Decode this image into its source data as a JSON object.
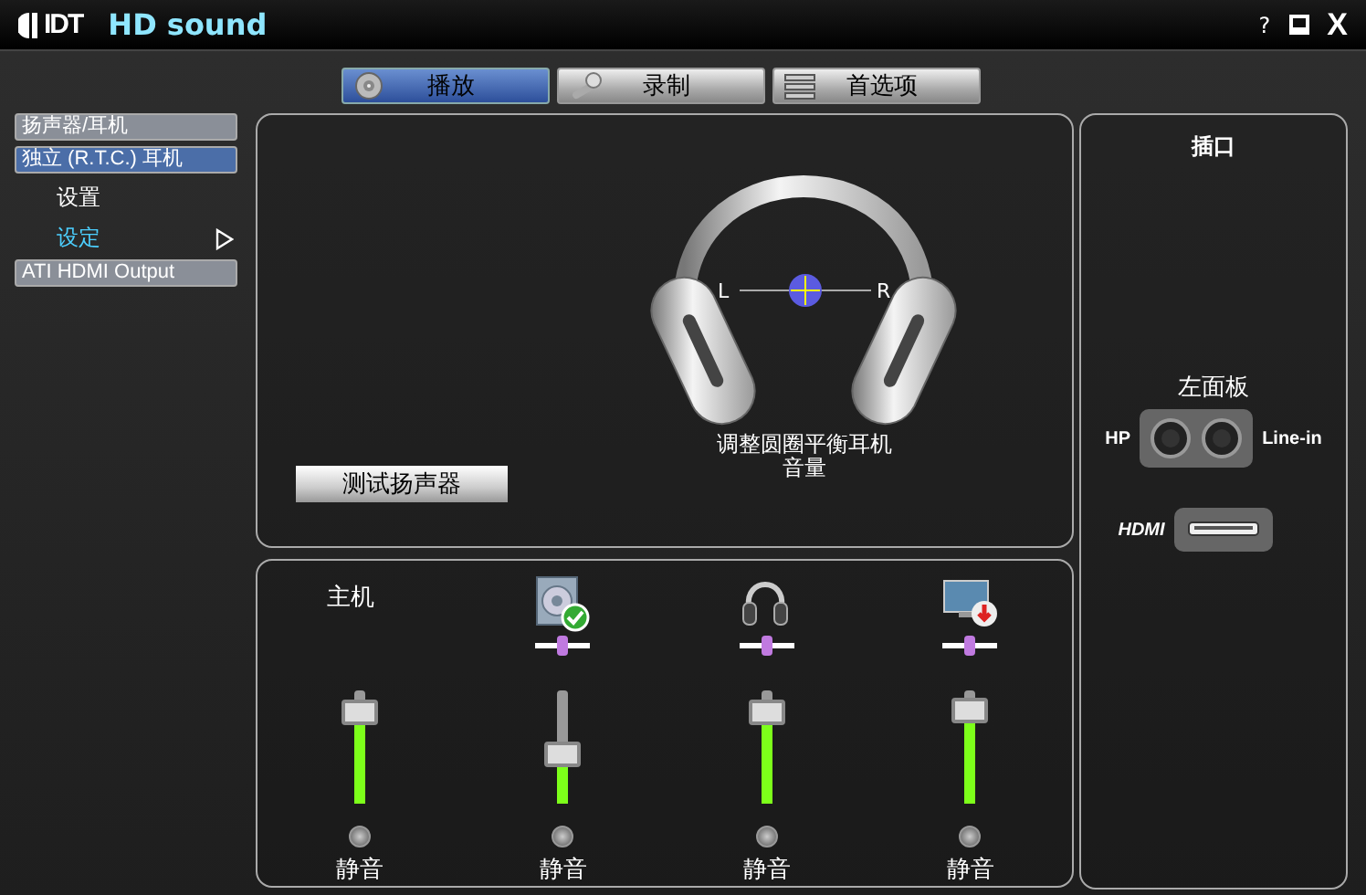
{
  "window": {
    "logo": "IDT",
    "title": "HD sound",
    "help": "?",
    "close": "X"
  },
  "tabs": [
    {
      "label": "播放",
      "selected": true
    },
    {
      "label": "录制",
      "selected": false
    },
    {
      "label": "首选项",
      "selected": false
    }
  ],
  "devices": [
    {
      "label": "扬声器/耳机",
      "selected": false
    },
    {
      "label": "独立 (R.T.C.) 耳机",
      "selected": true,
      "children": [
        {
          "label": "设置",
          "selected": false
        },
        {
          "label": "设定",
          "selected": true
        }
      ]
    },
    {
      "label": "ATI HDMI Output",
      "selected": false
    }
  ],
  "balance": {
    "left": "L",
    "right": "R",
    "level": 0.5,
    "hint": "调整圆圈平衡耳机音量"
  },
  "test_button": "测试扬声器",
  "mixer": [
    {
      "kind": "master",
      "label": "主机",
      "level": 0.8,
      "mute": "静音"
    },
    {
      "kind": "speaker",
      "balance": {
        "level": 0.5
      },
      "level": 0.43,
      "mute": "静音"
    },
    {
      "kind": "headphones",
      "balance": {
        "level": 0.5
      },
      "level": 0.8,
      "mute": "静音"
    },
    {
      "kind": "monitor",
      "balance": {
        "level": 0.5
      },
      "level": 0.82,
      "mute": "静音"
    }
  ],
  "jacks": {
    "title": "插口",
    "panel": "左面板",
    "hp": "HP",
    "line_in": "Line-in",
    "hdmi": "HDMI"
  }
}
